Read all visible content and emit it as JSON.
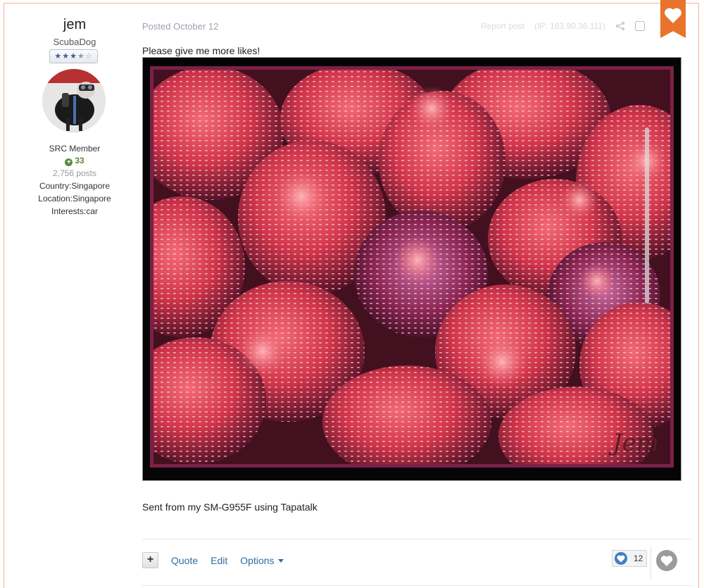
{
  "author": {
    "name": "jem",
    "title": "ScubaDog",
    "rank_stars": 3.5,
    "group": "SRC Member",
    "reputation": "33",
    "post_count": "2,756 posts",
    "fields": [
      {
        "label": "Country:",
        "value": "Singapore"
      },
      {
        "label": "Location:",
        "value": "Singapore"
      },
      {
        "label": "Interests:",
        "value": "car"
      }
    ]
  },
  "post": {
    "posted": "Posted October 12",
    "report": "Report post",
    "ip": "(IP: 183.90.36.111)",
    "text": "Please give me more likes!",
    "image_signature": "Jem",
    "footer_text": "Sent from my SM-G955F using Tapatalk"
  },
  "actions": {
    "plus": "+",
    "quote": "Quote",
    "edit": "Edit",
    "options": "Options"
  },
  "reactions": {
    "count": "12"
  },
  "icons": {
    "share": "share-icon",
    "ribbon": "heart-icon",
    "reaction": "heart-icon",
    "react_button": "heart-icon"
  },
  "colors": {
    "accent": "#e8732c",
    "link": "#2f6ea3",
    "reputation": "#5a8a3a",
    "reaction_badge": "#3f7fc2"
  }
}
